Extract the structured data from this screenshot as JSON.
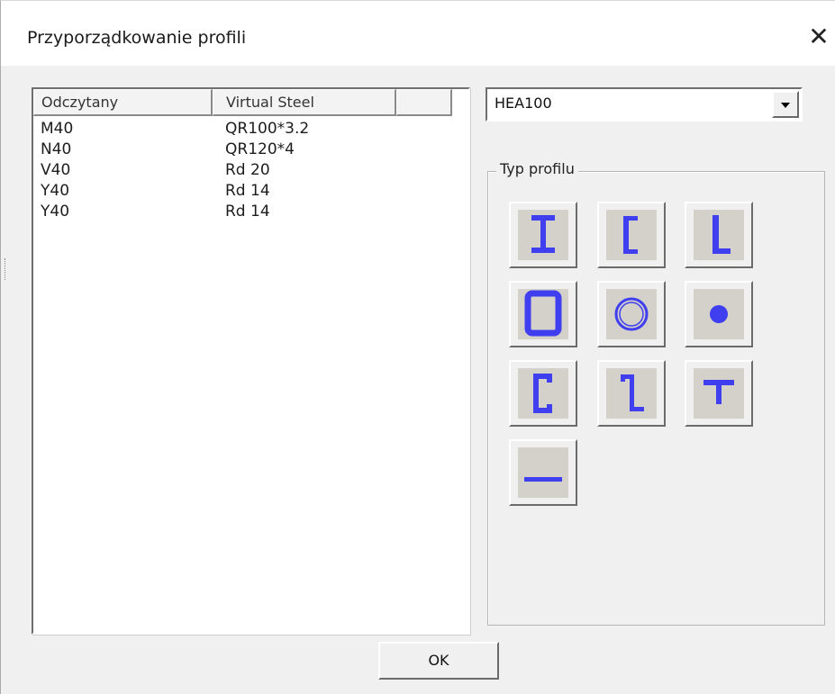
{
  "dialog": {
    "title": "Przyporządkowanie profili",
    "close_glyph": "✕"
  },
  "list": {
    "columns": [
      "Odczytany",
      "Virtual Steel",
      ""
    ],
    "rows": [
      {
        "read": "M40",
        "virtual": "QR100*3.2"
      },
      {
        "read": "N40",
        "virtual": "QR120*4"
      },
      {
        "read": "V40",
        "virtual": "Rd 20"
      },
      {
        "read": "Y40",
        "virtual": "Rd 14"
      },
      {
        "read": "Y40",
        "virtual": "Rd 14"
      }
    ]
  },
  "profile_combo": {
    "selected": "HEA100"
  },
  "profile_type": {
    "label": "Typ profilu",
    "icon_color": "#3f3ff0",
    "buttons": [
      {
        "icon": "i-beam-icon"
      },
      {
        "icon": "channel-bracket-icon"
      },
      {
        "icon": "angle-icon"
      },
      {
        "icon": "square-tube-icon"
      },
      {
        "icon": "round-tube-icon"
      },
      {
        "icon": "round-bar-icon"
      },
      {
        "icon": "c-channel-icon"
      },
      {
        "icon": "z-profile-icon"
      },
      {
        "icon": "t-profile-icon"
      },
      {
        "icon": "flat-bar-icon"
      }
    ]
  },
  "footer": {
    "ok_label": "OK"
  }
}
